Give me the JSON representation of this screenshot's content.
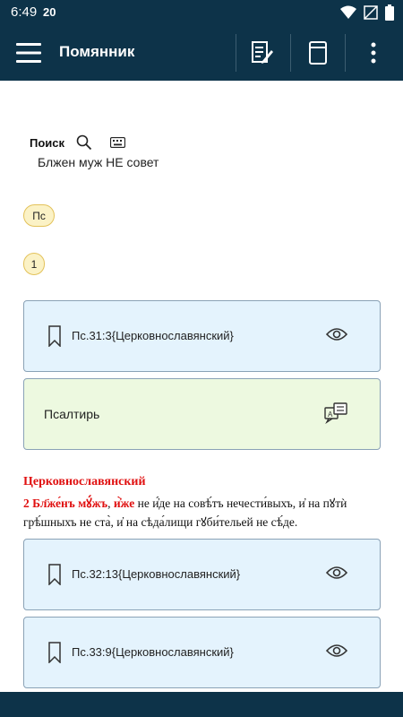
{
  "status_bar": {
    "time": "6:49",
    "notification": "20"
  },
  "app_bar": {
    "title": "Помянник"
  },
  "search": {
    "label": "Поиск",
    "query": "Блжен муж НЕ совет"
  },
  "chips": [
    {
      "label": "Пс"
    },
    {
      "label": "1"
    }
  ],
  "results": [
    {
      "ref": "Пс.31:3{Церковнославянский}"
    },
    {
      "ref": "Пс.32:13{Церковнославянский}"
    },
    {
      "ref": "Пс.33:9{Церковнославянский}"
    }
  ],
  "book_card": {
    "label": "Псалтирь"
  },
  "verse": {
    "heading": "Церковнославянский",
    "number": "2",
    "red_word": "Бл҃же́нъ",
    "red_word2": "мꙋ́жъ",
    "text_part1": ",",
    "red_word3": "и҆̀же",
    "text_part2": "не и҆́де на совѣ́тъ нечести́выхъ, и҆ на пꙋтѝ грѣ́шныхъ не ста̀, и҆ на сѣда́лищи гꙋби́тельей не сѣ́де."
  },
  "colors": {
    "bar": "#0d3349",
    "accent_red": "#e01010",
    "card_blue": "#e4f3fd",
    "card_green": "#edf9e0",
    "chip": "#fbf2c6"
  }
}
